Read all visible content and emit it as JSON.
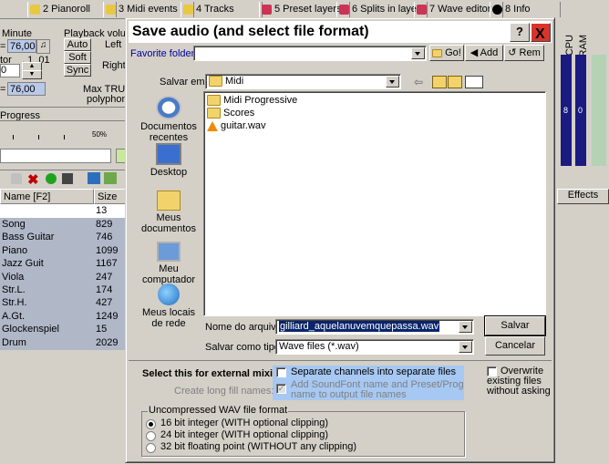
{
  "app": {
    "tabs": [
      {
        "label": "2 Pianoroll",
        "color": "#3a5fcd"
      },
      {
        "label": "3 Midi events",
        "color": "#4a7a2a"
      },
      {
        "label": "4 Tracks",
        "color": "#2e8b57"
      },
      {
        "label": "5 Preset layers",
        "color": "#b03060"
      },
      {
        "label": "6 Splits in layer",
        "color": "#8a2be2"
      },
      {
        "label": "7 Wave editor",
        "color": "#cc4400"
      },
      {
        "label": "8 Info",
        "color": "#1e3c96"
      }
    ],
    "minute_label": "Minute",
    "tempo_value": "= 76,00",
    "tempo_value2": "= 76,00",
    "tor_label": "tor",
    "tor_value": ". 1 .01",
    "zero_value": "0",
    "playback_volume": "Playback volume",
    "auto_btn": "Auto",
    "soft_btn": "Soft",
    "sync_btn": "Sync",
    "left_label": "Left",
    "right_label": "Right",
    "max_true": "Max TRUE",
    "polyphony": "polyphony:",
    "progress_label": "Progress",
    "progress_pct": "50%",
    "cpu_label": "CPU",
    "ram_label": "RAM",
    "cpu_value": "8",
    "ram_value": "0",
    "effects_btn": "Effects",
    "col_name": "Name [F2]",
    "col_size": "Size",
    "first_size": "13",
    "rows": [
      {
        "name": "Song",
        "size": "829"
      },
      {
        "name": "Bass Guitar",
        "size": "746"
      },
      {
        "name": "Piano",
        "size": "1099"
      },
      {
        "name": "Jazz Guit",
        "size": "1167"
      },
      {
        "name": "Viola",
        "size": "247"
      },
      {
        "name": "Str.L.",
        "size": "174"
      },
      {
        "name": "Str.H.",
        "size": "427"
      },
      {
        "name": "A.Gt.",
        "size": "1249"
      },
      {
        "name": "Glockenspiel",
        "size": "15"
      },
      {
        "name": "Drum",
        "size": "2029"
      }
    ]
  },
  "dialog": {
    "title": "Save audio (and select file format)",
    "help_btn": "?",
    "close_btn": "X",
    "favorite_label": "Favorite folders:",
    "favorite_value": "",
    "go_btn": "Go!",
    "add_btn": "Add",
    "rem_btn": "Rem",
    "save_in_label": "Salvar em:",
    "save_in_value": "Midi",
    "places": [
      {
        "label": "Documentos recentes",
        "icon": "recent-documents-icon"
      },
      {
        "label": "Desktop",
        "icon": "desktop-icon"
      },
      {
        "label": "Meus documentos",
        "icon": "my-documents-icon"
      },
      {
        "label": "Meu computador",
        "icon": "my-computer-icon"
      },
      {
        "label": "Meus locais de rede",
        "icon": "network-places-icon"
      }
    ],
    "files": [
      {
        "name": "Midi Progressive",
        "icon": "folder-icon"
      },
      {
        "name": "Scores",
        "icon": "folder-icon"
      },
      {
        "name": "guitar.wav",
        "icon": "vlc-audio-icon"
      }
    ],
    "filename_label": "Nome do arquivo:",
    "filename_value": "gilliard_aquelanuvemquepassa.wav",
    "filetype_label": "Salvar como tipo:",
    "filetype_value": "Wave files (*.wav)",
    "save_btn": "Salvar",
    "cancel_btn": "Cancelar",
    "external_mixing_label": "Select this for external mixing:",
    "separate_channels": "Separate channels into separate files",
    "long_fill_label": "Create long fill names:",
    "add_soundfont": "Add SoundFont name and Preset/Prog name to output file names",
    "overwrite": "Overwrite existing files without asking",
    "wav_format_legend": "Uncompressed WAV file format",
    "formats": [
      {
        "label": "16 bit integer (WITH optional clipping)",
        "checked": true
      },
      {
        "label": "24 bit integer (WITH optional clipping)",
        "checked": false
      },
      {
        "label": "32 bit floating point (WITHOUT any clipping)",
        "checked": false
      }
    ]
  }
}
